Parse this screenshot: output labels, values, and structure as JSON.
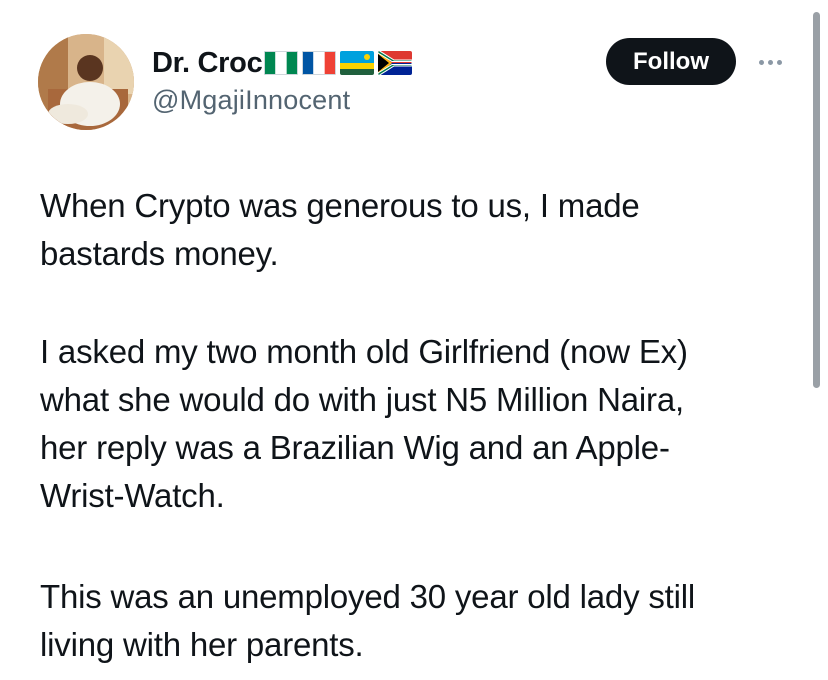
{
  "author": {
    "display_name": "Dr. Croc",
    "handle": "@MgajiInnocent",
    "flags": [
      "nigeria-flag-icon",
      "france-flag-icon",
      "rwanda-flag-icon",
      "south-africa-flag-icon"
    ]
  },
  "actions": {
    "follow_label": "Follow",
    "more_icon": "more-options-icon"
  },
  "tweet": {
    "paragraphs": [
      {
        "lines": [
          "When Crypto was generous to us, I made",
          "bastards money."
        ]
      },
      {
        "lines": [
          "I asked my two month old Girlfriend (now Ex)",
          "what she would do with just N5 Million Naira,",
          "her reply was a Brazilian Wig and an Apple-",
          "Wrist-Watch."
        ]
      },
      {
        "lines": [
          "This was an unemployed 30 year old lady still",
          "living with her parents."
        ]
      }
    ]
  },
  "colors": {
    "text": "#0f1419",
    "secondary_text": "#536471",
    "follow_bg": "#0f1419",
    "follow_text": "#ffffff"
  }
}
